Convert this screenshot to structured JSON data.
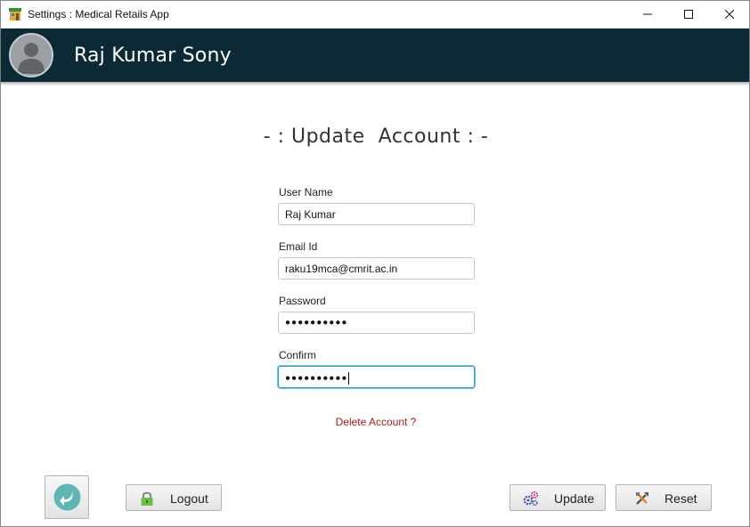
{
  "window": {
    "title": "Settings : Medical Retails App",
    "minimize_icon": "minimize-icon",
    "maximize_icon": "maximize-icon",
    "close_icon": "close-icon"
  },
  "header": {
    "user_name": "Raj Kumar Sony",
    "avatar_icon": "user-silhouette-icon",
    "background": "#0b2a36"
  },
  "form": {
    "heading": "- : Update  Account : -",
    "fields": [
      {
        "label": "User Name",
        "value": "Raj Kumar"
      },
      {
        "label": "Email Id",
        "value": "raku19mca@cmrit.ac.in"
      },
      {
        "label": "Password",
        "value": "●●●●●●●●●●"
      },
      {
        "label": "Confirm",
        "value": "●●●●●●●●●●"
      }
    ],
    "delete_link": "Delete Account ?"
  },
  "buttons": {
    "back_icon": "back-arrow-icon",
    "logout": "Logout",
    "update": "Update",
    "reset": "Reset"
  },
  "colors": {
    "accent_focus": "#1e9ad6",
    "link": "#a3211c",
    "back_icon": "#5fb6b4"
  }
}
